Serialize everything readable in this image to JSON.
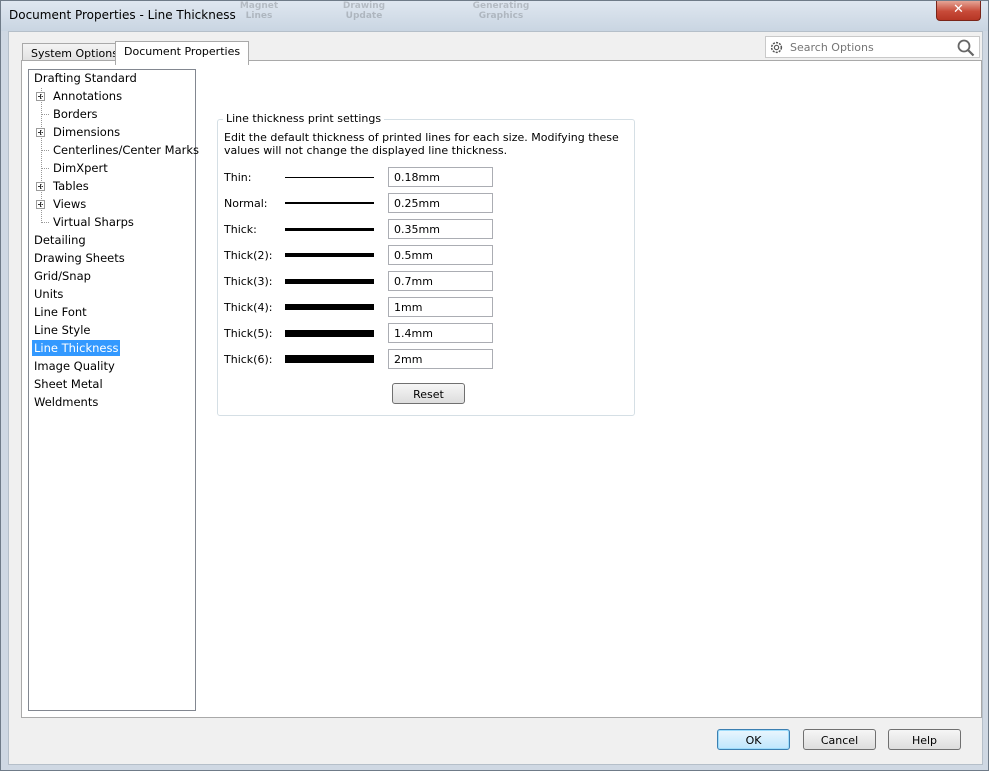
{
  "window": {
    "title": "Document Properties - Line Thickness",
    "background_toolbar_text": [
      "Magnet Lines",
      "Drawing Update",
      "Generating Graphics"
    ]
  },
  "tabs": [
    "System Options",
    "Document Properties"
  ],
  "search": {
    "placeholder": "Search Options"
  },
  "tree": {
    "items": [
      {
        "label": "Drafting Standard"
      },
      {
        "label": "Annotations"
      },
      {
        "label": "Borders"
      },
      {
        "label": "Dimensions"
      },
      {
        "label": "Centerlines/Center Marks"
      },
      {
        "label": "DimXpert"
      },
      {
        "label": "Tables"
      },
      {
        "label": "Views"
      },
      {
        "label": "Virtual Sharps"
      },
      {
        "label": "Detailing"
      },
      {
        "label": "Drawing Sheets"
      },
      {
        "label": "Grid/Snap"
      },
      {
        "label": "Units"
      },
      {
        "label": "Line Font"
      },
      {
        "label": "Line Style"
      },
      {
        "label": "Line Thickness"
      },
      {
        "label": "Image Quality"
      },
      {
        "label": "Sheet Metal"
      },
      {
        "label": "Weldments"
      }
    ],
    "selected": "Line Thickness"
  },
  "print_settings": {
    "caption": "Line thickness print settings",
    "description": "Edit the default thickness of printed lines for each size.  Modifying these values will not change the displayed line thickness.",
    "rows": [
      {
        "label": "Thin:",
        "value": "0.18mm"
      },
      {
        "label": "Normal:",
        "value": "0.25mm"
      },
      {
        "label": "Thick:",
        "value": "0.35mm"
      },
      {
        "label": "Thick(2):",
        "value": "0.5mm"
      },
      {
        "label": "Thick(3):",
        "value": "0.7mm"
      },
      {
        "label": "Thick(4):",
        "value": "1mm"
      },
      {
        "label": "Thick(5):",
        "value": "1.4mm"
      },
      {
        "label": "Thick(6):",
        "value": "2mm"
      }
    ],
    "reset_label": "Reset"
  },
  "footer": {
    "ok": "OK",
    "cancel": "Cancel",
    "help": "Help"
  },
  "colors": {
    "selection": "#3399ff",
    "close_button": "#c74a38"
  }
}
